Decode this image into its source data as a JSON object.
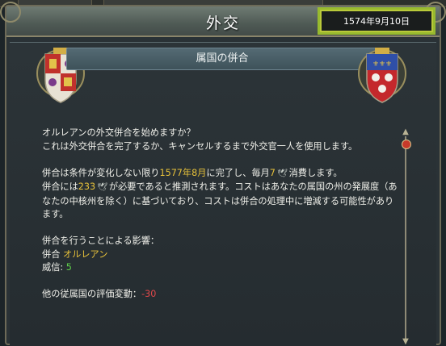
{
  "header": {
    "title": "外交",
    "date": "1574年9月10日"
  },
  "subheader": {
    "title": "属国の併合"
  },
  "body": {
    "question": "オルレアンの外交併合を始めますか？",
    "line2": "これは外交併合を完了するか、キャンセルするまで外交官一人を使用します。",
    "p2_a": "併合は条件が変化しない限り",
    "p2_date": "1577年8月",
    "p2_b": "に完了し、毎月",
    "p2_num": "7",
    "p2_c": "消費します。",
    "p3_a": "併合には",
    "p3_num": "233",
    "p3_b": "が必要であると推測されます。コストはあなたの属国の州の発展度（あなたの中核州を除く）に基づいており、コストは併合の処理中に増減する可能性があります。",
    "effects_header": "併合を行うことによる影響：",
    "annex_label": "併合",
    "annex_target": "オルレアン",
    "prestige_label": "威信:",
    "prestige_value": "5",
    "opinion_label": "他の従属国の評価変動：",
    "opinion_value": "-30"
  },
  "icons": {
    "diplomat": "dove-icon",
    "colors": {
      "highlight": "#b9c93a",
      "gold": "#e8c23a",
      "green": "#5fd04a",
      "red": "#e0484a"
    }
  }
}
